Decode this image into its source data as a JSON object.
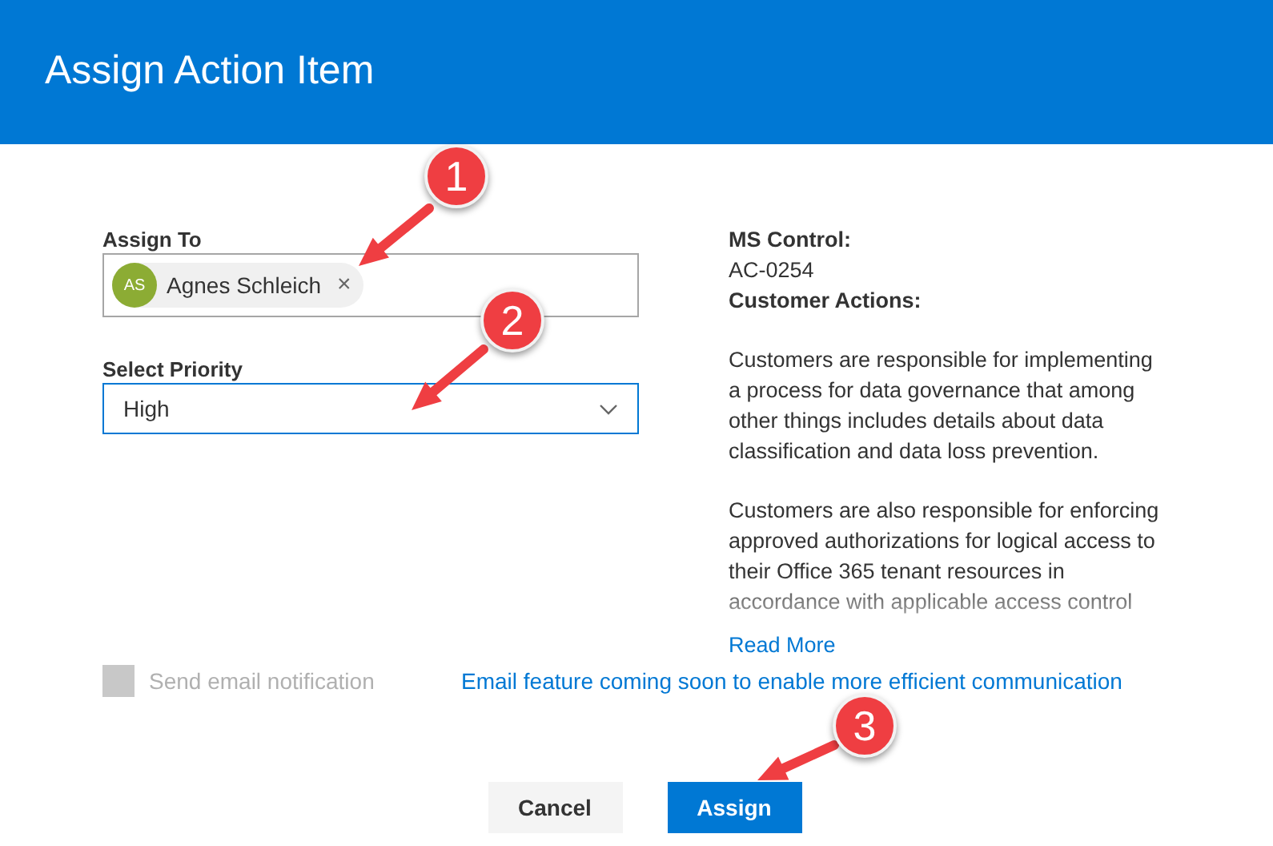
{
  "dialog": {
    "title": "Assign Action Item"
  },
  "assign_to": {
    "label": "Assign To",
    "people": [
      {
        "initials": "AS",
        "name": "Agnes Schleich",
        "color": "#8cac34",
        "remove": "×"
      }
    ]
  },
  "priority": {
    "label": "Select Priority",
    "value": "High"
  },
  "details": {
    "control_label": "MS Control:",
    "control_value": "AC-0254",
    "actions_label": "Customer Actions:",
    "paragraphs": [
      "Customers are responsible for implementing a process for data governance that among other things includes details about data classification and data loss prevention.",
      "Customers are also responsible for enforcing approved authorizations for logical access to their Office 365 tenant resources in accordance with applicable access control"
    ],
    "read_more": "Read More"
  },
  "email_notification": {
    "label": "Send email notification",
    "checked": false,
    "disabled": true
  },
  "email_note": "Email feature coming soon to enable more efficient communication",
  "buttons": [
    {
      "label": "Cancel",
      "kind": "secondary"
    },
    {
      "label": "Assign",
      "kind": "primary"
    }
  ],
  "annotations": [
    {
      "label": "1"
    },
    {
      "label": "2"
    },
    {
      "label": "3"
    }
  ]
}
